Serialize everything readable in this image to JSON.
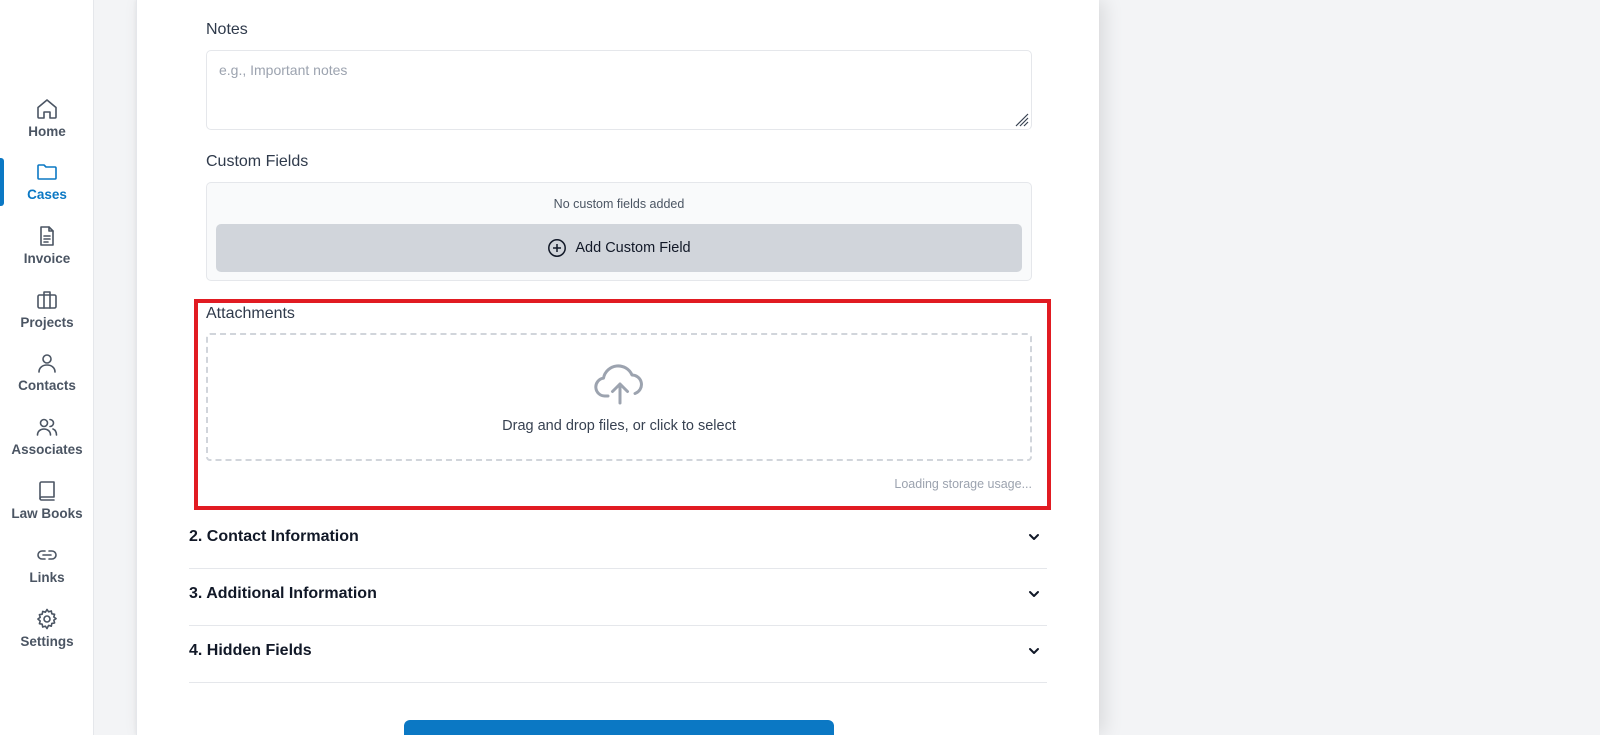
{
  "sidebar": {
    "items": [
      {
        "label": "Home",
        "icon": "home-icon"
      },
      {
        "label": "Cases",
        "icon": "folder-icon",
        "active": true
      },
      {
        "label": "Invoice",
        "icon": "document-icon"
      },
      {
        "label": "Projects",
        "icon": "briefcase-icon"
      },
      {
        "label": "Contacts",
        "icon": "user-icon"
      },
      {
        "label": "Associates",
        "icon": "users-icon"
      },
      {
        "label": "Law Books",
        "icon": "book-icon"
      },
      {
        "label": "Links",
        "icon": "link-icon"
      },
      {
        "label": "Settings",
        "icon": "gear-icon"
      }
    ]
  },
  "form": {
    "notes": {
      "label": "Notes",
      "placeholder": "e.g., Important notes"
    },
    "custom_fields": {
      "label": "Custom Fields",
      "empty_text": "No custom fields added",
      "add_label": "Add Custom Field"
    },
    "attachments": {
      "label": "Attachments",
      "drop_text": "Drag and drop files, or click to select",
      "storage_text": "Loading storage usage..."
    },
    "sections": [
      {
        "title": "2. Contact Information"
      },
      {
        "title": "3. Additional Information"
      },
      {
        "title": "4. Hidden Fields"
      }
    ]
  },
  "colors": {
    "accent": "#0b78c4",
    "highlight": "#e11b22"
  }
}
